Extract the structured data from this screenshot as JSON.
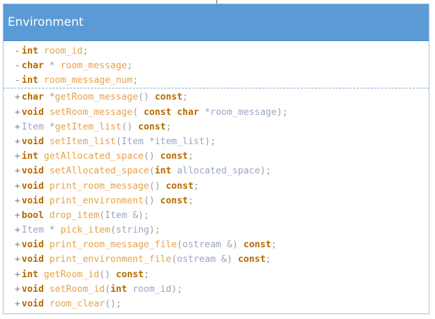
{
  "class_name": "Environment",
  "attributes": [
    {
      "visibility": "-",
      "parts": [
        {
          "t": "int",
          "c": "kw"
        },
        {
          "t": " room_id",
          "c": "id"
        },
        {
          "t": ";",
          "c": "pu"
        }
      ]
    },
    {
      "visibility": "-",
      "parts": [
        {
          "t": "char",
          "c": "kw"
        },
        {
          "t": " * ",
          "c": "pu"
        },
        {
          "t": "room_message",
          "c": "id"
        },
        {
          "t": ";",
          "c": "pu"
        }
      ]
    },
    {
      "visibility": "-",
      "parts": [
        {
          "t": "int",
          "c": "kw"
        },
        {
          "t": " room_message_num",
          "c": "id"
        },
        {
          "t": ";",
          "c": "pu"
        }
      ]
    }
  ],
  "methods": [
    {
      "visibility": "+",
      "parts": [
        {
          "t": "char",
          "c": "kw"
        },
        {
          "t": " *",
          "c": "pu"
        },
        {
          "t": "getRoom_message",
          "c": "id"
        },
        {
          "t": "() ",
          "c": "pu"
        },
        {
          "t": "const",
          "c": "kw"
        },
        {
          "t": ";",
          "c": "pu"
        }
      ]
    },
    {
      "visibility": "+",
      "parts": [
        {
          "t": "void",
          "c": "kw"
        },
        {
          "t": " setRoom_message",
          "c": "id"
        },
        {
          "t": "( ",
          "c": "pu"
        },
        {
          "t": "const",
          "c": "kw"
        },
        {
          "t": " ",
          "c": "pu"
        },
        {
          "t": "char",
          "c": "kw"
        },
        {
          "t": " *room_message",
          "c": "ty"
        },
        {
          "t": ");",
          "c": "pu"
        }
      ]
    },
    {
      "visibility": "+",
      "parts": [
        {
          "t": "Item",
          "c": "ty"
        },
        {
          "t": " *",
          "c": "pu"
        },
        {
          "t": "getItem_list",
          "c": "id"
        },
        {
          "t": "() ",
          "c": "pu"
        },
        {
          "t": "const",
          "c": "kw"
        },
        {
          "t": ";",
          "c": "pu"
        }
      ]
    },
    {
      "visibility": "+",
      "parts": [
        {
          "t": "void",
          "c": "kw"
        },
        {
          "t": " setItem_list",
          "c": "id"
        },
        {
          "t": "(",
          "c": "pu"
        },
        {
          "t": "Item *item_list",
          "c": "ty"
        },
        {
          "t": ");",
          "c": "pu"
        }
      ]
    },
    {
      "visibility": "+",
      "parts": [
        {
          "t": "int",
          "c": "kw"
        },
        {
          "t": " getAllocated_space",
          "c": "id"
        },
        {
          "t": "() ",
          "c": "pu"
        },
        {
          "t": "const",
          "c": "kw"
        },
        {
          "t": ";",
          "c": "pu"
        }
      ]
    },
    {
      "visibility": "+",
      "parts": [
        {
          "t": "void",
          "c": "kw"
        },
        {
          "t": " setAllocated_space",
          "c": "id"
        },
        {
          "t": "(",
          "c": "pu"
        },
        {
          "t": "int",
          "c": "kw"
        },
        {
          "t": " allocated_space",
          "c": "ty"
        },
        {
          "t": ");",
          "c": "pu"
        }
      ]
    },
    {
      "visibility": "+",
      "parts": [
        {
          "t": "void",
          "c": "kw"
        },
        {
          "t": " print_room_message",
          "c": "id"
        },
        {
          "t": "() ",
          "c": "pu"
        },
        {
          "t": "const",
          "c": "kw"
        },
        {
          "t": ";",
          "c": "pu"
        }
      ]
    },
    {
      "visibility": "+",
      "parts": [
        {
          "t": "void",
          "c": "kw"
        },
        {
          "t": " print_environment",
          "c": "id"
        },
        {
          "t": "() ",
          "c": "pu"
        },
        {
          "t": "const",
          "c": "kw"
        },
        {
          "t": ";",
          "c": "pu"
        }
      ]
    },
    {
      "visibility": "+",
      "parts": [
        {
          "t": "bool",
          "c": "kw"
        },
        {
          "t": " drop_item",
          "c": "id"
        },
        {
          "t": "(",
          "c": "pu"
        },
        {
          "t": "Item &",
          "c": "ty"
        },
        {
          "t": ");",
          "c": "pu"
        }
      ]
    },
    {
      "visibility": "+",
      "parts": [
        {
          "t": "Item",
          "c": "ty"
        },
        {
          "t": " * ",
          "c": "pu"
        },
        {
          "t": "pick_item",
          "c": "id"
        },
        {
          "t": "(",
          "c": "pu"
        },
        {
          "t": "string",
          "c": "ty"
        },
        {
          "t": ");",
          "c": "pu"
        }
      ]
    },
    {
      "visibility": "+",
      "parts": [
        {
          "t": "void",
          "c": "kw"
        },
        {
          "t": " print_room_message_file",
          "c": "id"
        },
        {
          "t": "(",
          "c": "pu"
        },
        {
          "t": "ostream &",
          "c": "ty"
        },
        {
          "t": ") ",
          "c": "pu"
        },
        {
          "t": "const",
          "c": "kw"
        },
        {
          "t": ";",
          "c": "pu"
        }
      ]
    },
    {
      "visibility": "+",
      "parts": [
        {
          "t": "void",
          "c": "kw"
        },
        {
          "t": " print_environment_file",
          "c": "id"
        },
        {
          "t": "(",
          "c": "pu"
        },
        {
          "t": "ostream &",
          "c": "ty"
        },
        {
          "t": ") ",
          "c": "pu"
        },
        {
          "t": "const",
          "c": "kw"
        },
        {
          "t": ";",
          "c": "pu"
        }
      ]
    },
    {
      "visibility": "+",
      "parts": [
        {
          "t": "int",
          "c": "kw"
        },
        {
          "t": " getRoom_id",
          "c": "id"
        },
        {
          "t": "() ",
          "c": "pu"
        },
        {
          "t": "const",
          "c": "kw"
        },
        {
          "t": ";",
          "c": "pu"
        }
      ]
    },
    {
      "visibility": "+",
      "parts": [
        {
          "t": "void",
          "c": "kw"
        },
        {
          "t": " setRoom_id",
          "c": "id"
        },
        {
          "t": "(",
          "c": "pu"
        },
        {
          "t": "int",
          "c": "kw"
        },
        {
          "t": " room_id",
          "c": "ty"
        },
        {
          "t": ");",
          "c": "pu"
        }
      ]
    },
    {
      "visibility": "+",
      "parts": [
        {
          "t": "void",
          "c": "kw"
        },
        {
          "t": " room_clear",
          "c": "id"
        },
        {
          "t": "();",
          "c": "pu"
        }
      ]
    }
  ]
}
